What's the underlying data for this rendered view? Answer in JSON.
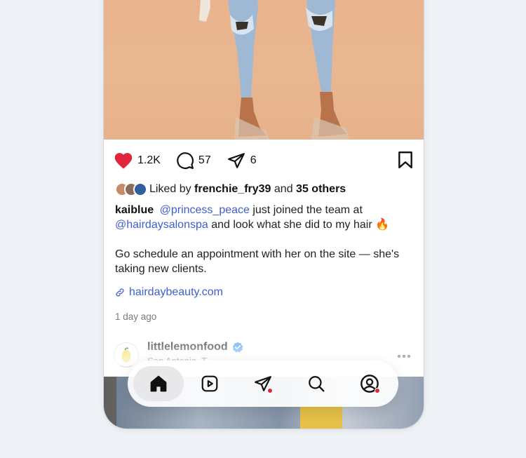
{
  "post": {
    "stats": {
      "likes": "1.2K",
      "comments": "57",
      "shares": "6"
    },
    "liked_by": {
      "prefix": "Liked by",
      "user": "frenchie_fry39",
      "mid": "and",
      "others": "35 others"
    },
    "caption": {
      "user": "kaiblue",
      "mention1": "@princess_peace",
      "text1": " just joined the team at",
      "mention2": "@hairdaysalonspa",
      "text2": " and look what she did to my hair 🔥",
      "paragraph2": "Go schedule an appointment with her on the site — she's taking new clients."
    },
    "link": "hairdaybeauty.com",
    "time": "1 day ago"
  },
  "next_post": {
    "username": "littlelemonfood",
    "location": "San Antonio, T..."
  },
  "colors": {
    "heart": "#e0263a",
    "mention": "#3f5fd0",
    "verified": "#3897f0",
    "notification": "#e0263a"
  },
  "icons": [
    "heart-icon",
    "comment-icon",
    "share-icon",
    "bookmark-icon",
    "link-icon",
    "verified-icon",
    "more-icon",
    "home-icon",
    "reels-icon",
    "messages-icon",
    "search-icon",
    "profile-icon"
  ]
}
